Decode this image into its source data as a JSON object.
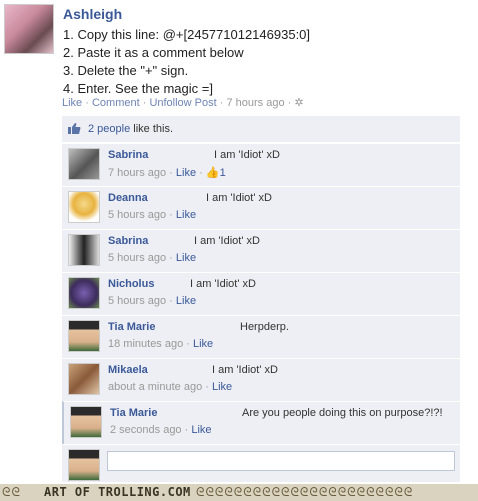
{
  "post": {
    "author": "Ashleigh",
    "lines": [
      "1. Copy this line: @+[245771012146935:0]",
      "2. Paste it as a comment below",
      "3. Delete the \"+\" sign.",
      "4. Enter. See the magic =]"
    ],
    "actions": {
      "like": "Like",
      "comment": "Comment",
      "unfollow": "Unfollow Post",
      "time": "7 hours ago"
    }
  },
  "likes": {
    "count_text": "2 people",
    "suffix": "like this."
  },
  "comments": [
    {
      "name": "Sabrina",
      "text": "I am 'Idiot' xD",
      "time": "7 hours ago",
      "like": "Like",
      "like_count": "1"
    },
    {
      "name": "Deanna",
      "text": "I am 'Idiot' xD",
      "time": "5 hours ago",
      "like": "Like"
    },
    {
      "name": "Sabrina",
      "text": "I am 'Idiot' xD",
      "time": "5 hours ago",
      "like": "Like"
    },
    {
      "name": "Nicholus",
      "text": "I am 'Idiot' xD",
      "time": "5 hours ago",
      "like": "Like"
    },
    {
      "name": "Tia Marie",
      "text": "Herpderp.",
      "time": "18 minutes ago",
      "like": "Like"
    },
    {
      "name": "Mikaela",
      "text": "I am 'Idiot' xD",
      "time": "about a minute ago",
      "like": "Like"
    },
    {
      "name": "Tia Marie",
      "text": "Are you people doing this on purpose?!?!",
      "time": "2 seconds ago",
      "like": "Like"
    }
  ],
  "footer": {
    "text": "ART OF TROLLING.COM"
  },
  "colors": {
    "link": "#3b5998",
    "box_bg": "#edeff4",
    "footer_bg": "#d9d3bf"
  }
}
